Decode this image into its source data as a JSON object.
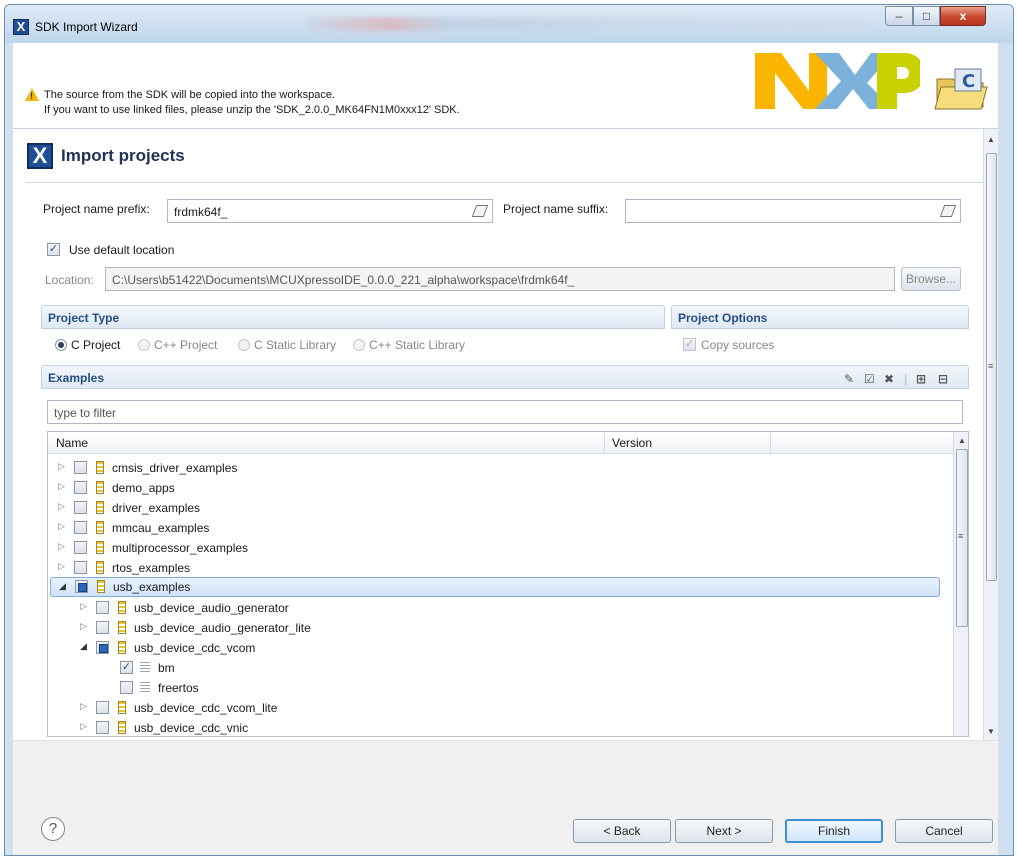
{
  "window": {
    "title": "SDK Import Wizard",
    "app_icon": "X",
    "minimize": "–",
    "maximize": "□",
    "close": "x"
  },
  "header": {
    "warning_line1": "The source from the SDK will be copied into the workspace.",
    "warning_line2": "If you want to use linked files, please unzip the 'SDK_2.0.0_MK64FN1M0xxx12' SDK.",
    "logo_icon": "nxp-logo",
    "logo_colors": [
      "#f9b500",
      "#7bb1db",
      "#c9d200"
    ]
  },
  "page": {
    "title": "Import projects",
    "title_icon": "X",
    "prefix_label": "Project name prefix:",
    "prefix_value": "frdmk64f_",
    "suffix_label": "Project name suffix:",
    "suffix_value": "",
    "use_default_label": "Use default location",
    "location_label": "Location:",
    "location_value": "C:\\Users\\b51422\\Documents\\MCUXpressoIDE_0.0.0_221_alpha\\workspace\\frdmk64f_",
    "browse_label": "Browse..."
  },
  "project_type": {
    "title": "Project Type",
    "options": [
      "C Project",
      "C++ Project",
      "C Static Library",
      "C++ Static Library"
    ],
    "selected": "C Project"
  },
  "project_options": {
    "title": "Project Options",
    "copy_sources_label": "Copy sources"
  },
  "examples": {
    "title": "Examples",
    "filter_placeholder": "type to filter",
    "columns": [
      "Name",
      "Version"
    ],
    "rows": [
      {
        "label": "cmsis_driver_examples"
      },
      {
        "label": "demo_apps"
      },
      {
        "label": "driver_examples"
      },
      {
        "label": "mmcau_examples"
      },
      {
        "label": "multiprocessor_examples"
      },
      {
        "label": "rtos_examples"
      },
      {
        "label": "usb_examples"
      },
      {
        "label": "usb_device_audio_generator"
      },
      {
        "label": "usb_device_audio_generator_lite"
      },
      {
        "label": "usb_device_cdc_vcom"
      },
      {
        "label": "bm"
      },
      {
        "label": "freertos"
      },
      {
        "label": "usb_device_cdc_vcom_lite"
      },
      {
        "label": "usb_device_cdc_vnic"
      }
    ]
  },
  "footer": {
    "help": "?",
    "back": "< Back",
    "next": "Next >",
    "finish": "Finish",
    "cancel": "Cancel"
  }
}
